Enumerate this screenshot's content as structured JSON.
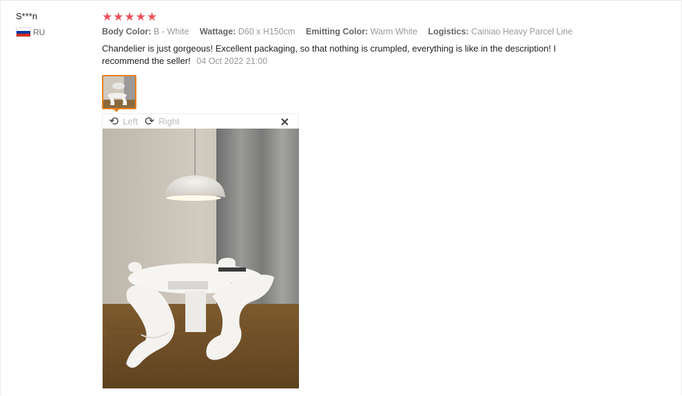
{
  "user": {
    "name": "S***n",
    "country_code": "RU",
    "flag_icon": "russia-flag-icon"
  },
  "review": {
    "rating": 5,
    "star_color": "#f0505a",
    "props": [
      {
        "key": "Body Color:",
        "value": "B - White"
      },
      {
        "key": "Wattage:",
        "value": "D60 x H150cm"
      },
      {
        "key": "Emitting Color:",
        "value": "Warm White"
      },
      {
        "key": "Logistics:",
        "value": "Cainiao Heavy Parcel Line"
      }
    ],
    "text": "Chandelier is just gorgeous! Excellent packaging, so that nothing is crumpled, everything is like in the description! I recommend the seller!",
    "date": "04 Oct 2022 21:00"
  },
  "viewer": {
    "rotate_left_label": "Left",
    "rotate_right_label": "Right",
    "close_glyph": "✕",
    "accent_color": "#e8801c"
  }
}
